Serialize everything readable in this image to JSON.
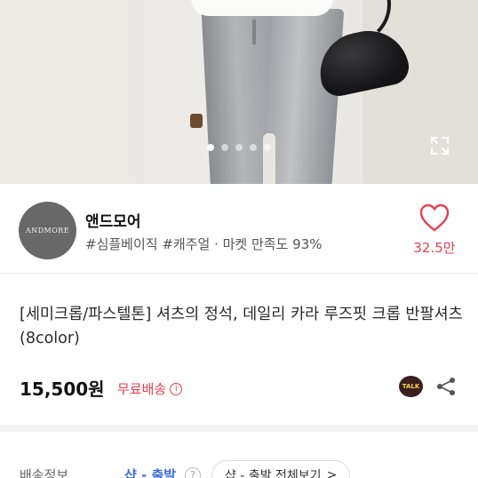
{
  "carousel": {
    "total_slides": 5,
    "active_slide": 1
  },
  "seller": {
    "logo_text": "ANDMORE",
    "name": "앤드모어",
    "tags": "#심플베이직 #캐주얼 · 마켓 만족도 93%",
    "like_count": "32.5만"
  },
  "product": {
    "title": "[세미크롭/파스텔톤] 셔츠의 정석, 데일리 카라 루즈핏 크롭 반팔셔츠 (8color)",
    "price": "15,500원",
    "shipping": "무료배송",
    "shipping_info_icon": "i"
  },
  "actions": {
    "kakao_label": "TALK"
  },
  "delivery": {
    "label": "배송정보",
    "value": "샵 - 출발",
    "help_icon": "?",
    "view_all_label": "샵 - 출발 전체보기",
    "view_all_icon": ">"
  },
  "colors": {
    "accent_red": "#e8404f",
    "link_blue": "#3b6ae0",
    "kakao_brown": "#3b1e1e",
    "kakao_yellow": "#f6d73f"
  }
}
